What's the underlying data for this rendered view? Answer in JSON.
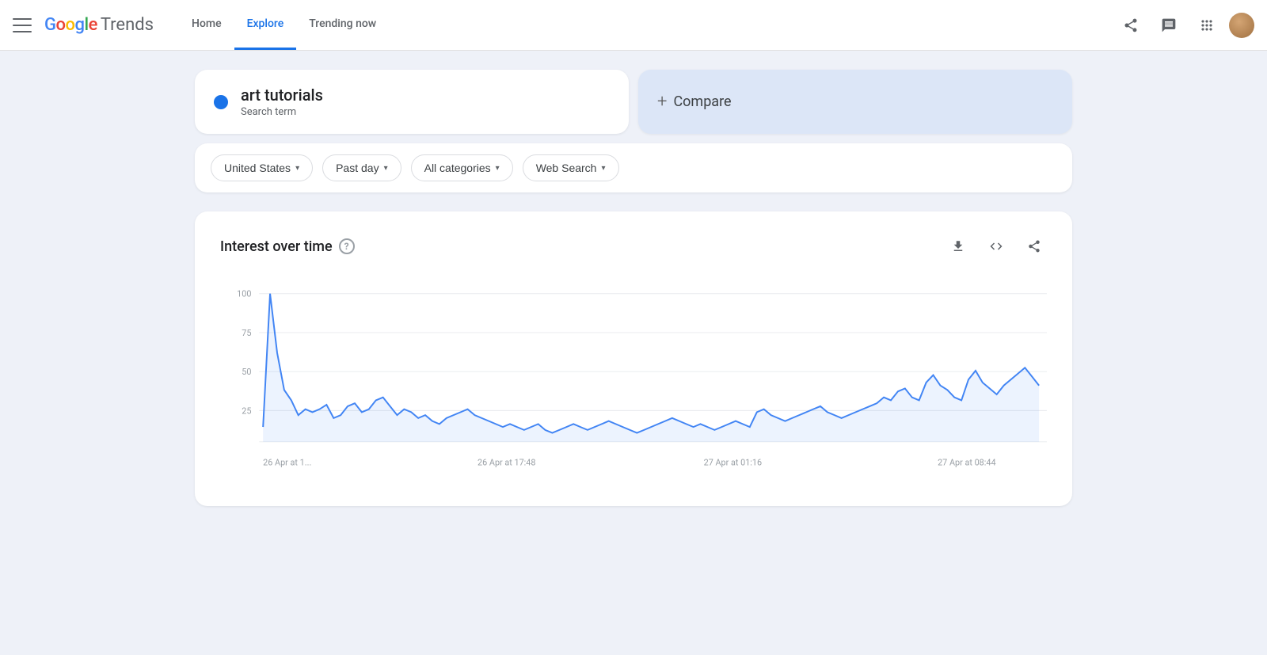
{
  "header": {
    "menu_icon_label": "Menu",
    "logo": {
      "google": "Google",
      "trends": " Trends"
    },
    "nav": [
      {
        "label": "Home",
        "active": false
      },
      {
        "label": "Explore",
        "active": true
      },
      {
        "label": "Trending now",
        "active": false
      }
    ],
    "share_icon": "share",
    "message_icon": "message",
    "apps_icon": "apps"
  },
  "search": {
    "term": "art tutorials",
    "type": "Search term",
    "dot_color": "#1a73e8",
    "compare_label": "Compare",
    "compare_plus": "+"
  },
  "filters": [
    {
      "label": "United States",
      "id": "location"
    },
    {
      "label": "Past day",
      "id": "time"
    },
    {
      "label": "All categories",
      "id": "category"
    },
    {
      "label": "Web Search",
      "id": "type"
    }
  ],
  "chart": {
    "title": "Interest over time",
    "help_char": "?",
    "y_labels": [
      "100",
      "75",
      "50",
      "25"
    ],
    "x_labels": [
      "26 Apr at 1...",
      "26 Apr at 17:48",
      "27 Apr at 01:16",
      "27 Apr at 08:44"
    ],
    "data_points": [
      10,
      100,
      60,
      35,
      28,
      18,
      22,
      20,
      22,
      25,
      16,
      18,
      24,
      26,
      20,
      22,
      28,
      30,
      24,
      18,
      22,
      20,
      16,
      18,
      14,
      12,
      16,
      18,
      20,
      22,
      18,
      16,
      14,
      12,
      10,
      12,
      10,
      8,
      10,
      12,
      8,
      6,
      8,
      10,
      12,
      10,
      8,
      10,
      12,
      14,
      12,
      10,
      8,
      6,
      8,
      10,
      12,
      14,
      16,
      14,
      12,
      10,
      12,
      10,
      8,
      10,
      12,
      14,
      12,
      10,
      20,
      22,
      18,
      16,
      14,
      16,
      18,
      20,
      22,
      24,
      20,
      18,
      16,
      18,
      20,
      22,
      24,
      26,
      30,
      28,
      34,
      36,
      30,
      28,
      40,
      45,
      38,
      35,
      30,
      28,
      42,
      48,
      40,
      36,
      32,
      38,
      42,
      46,
      50,
      44,
      38
    ]
  }
}
